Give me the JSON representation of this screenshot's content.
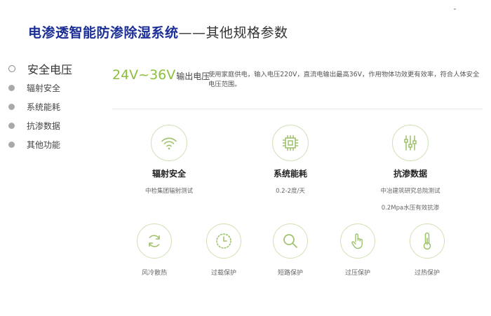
{
  "title": {
    "bold": "电渗透智能防渗除湿系统",
    "rest": "——其他规格参数"
  },
  "sidebar": {
    "items": [
      {
        "label": "安全电压",
        "active": true
      },
      {
        "label": "辐射安全",
        "active": false
      },
      {
        "label": "系统能耗",
        "active": false
      },
      {
        "label": "抗渗数据",
        "active": false
      },
      {
        "label": "其他功能",
        "active": false
      }
    ]
  },
  "voltage": {
    "range": "24V~36V",
    "unit_label": "输出电压"
  },
  "description": "使用家庭供电，输入电压220V，直流电输出最高36V，作用物体功效更有效率，符合人体安全电压范围。",
  "features": [
    {
      "icon": "wifi-icon",
      "name": "辐射安全",
      "sub": "中检集团辐射测试"
    },
    {
      "icon": "chip-icon",
      "name": "系统能耗",
      "sub": "0.2-2度/天"
    },
    {
      "icon": "sliders-icon",
      "name": "抗渗数据",
      "sub": "中冶建筑研究总院测试",
      "sub2": "0.2Mpa水压有效抗渗"
    }
  ],
  "protections": [
    {
      "icon": "recycle-icon",
      "name": "风冷散热"
    },
    {
      "icon": "clock-icon",
      "name": "过载保护"
    },
    {
      "icon": "magnifier-icon",
      "name": "短路保护"
    },
    {
      "icon": "hand-icon",
      "name": "过压保护"
    },
    {
      "icon": "thermometer-icon",
      "name": "过热保护"
    }
  ],
  "colors": {
    "title_blue": "#1c2f96",
    "accent_green": "#8cbf3d",
    "circle_border": "#cfe2b4",
    "icon_green": "#9dc16a"
  }
}
